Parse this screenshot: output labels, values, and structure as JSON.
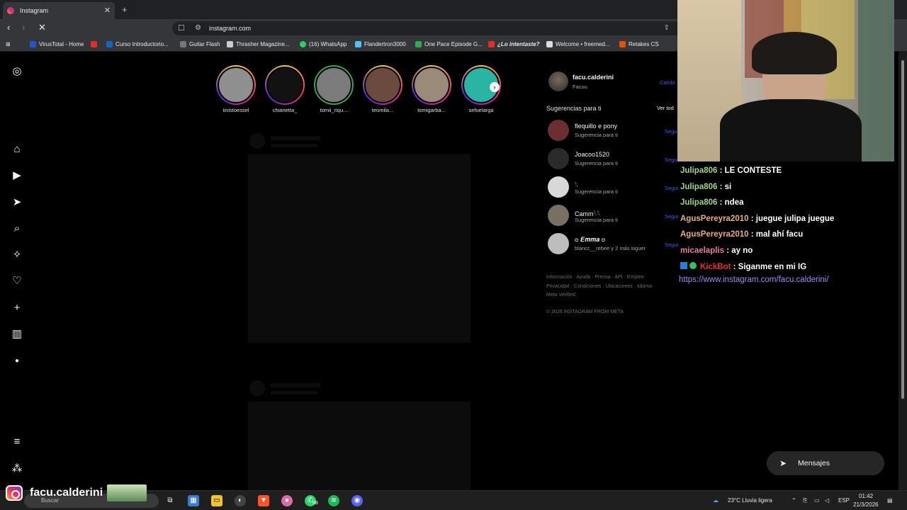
{
  "browser": {
    "tab_title": "Instagram",
    "url": "instagram.com",
    "bookmarks": [
      "VirusTotal - Home",
      "Curso Introductorio...",
      "Guitar Flash",
      "Thrasher Magazine...",
      "(16) WhatsApp",
      "Flandertron3000",
      "One Pace Episode G...",
      "¿Lo intentaste?",
      "Welcome • freemed...",
      "Retakes CS"
    ]
  },
  "stories": [
    "tinistoessel",
    "chianetta_",
    "tomii_riqu...",
    "teomila...",
    "tomigarba...",
    "sefuelarga"
  ],
  "profile": {
    "username": "facu.calderini",
    "name": "Facuu",
    "switch_label": "Cambi"
  },
  "suggestions": {
    "header": "Sugerencias para ti",
    "see_all": "Ver tod",
    "follow_label": "Segui",
    "items": [
      {
        "name": "flequillo e pony",
        "sub": "Sugerencia para ti"
      },
      {
        "name": "Joacoo1520",
        "sub": "Sugerencia para ti"
      },
      {
        "name": "𓆩",
        "sub": "Sugerencia para ti"
      },
      {
        "name": "Camm𓆩𓆩",
        "sub": "Sugerencia para ti"
      },
      {
        "name": "ᴑ 𝑬𝒎𝒎𝒂 ᴑ",
        "sub": "blancc__rebee y 2 más siguer"
      }
    ]
  },
  "footer": {
    "line1": "Información · Ayuda · Prensa · API · Empleo ·",
    "line2": "Privacidad · Condiciones · Ubicaciones · Idioma ·",
    "line3": "Meta Verified",
    "copyright": "© 2026 INSTAGRAM FROM META"
  },
  "chat": [
    {
      "user": "Julipa806",
      "text": ": LE CONTESTE",
      "color": "#9fd38a"
    },
    {
      "user": "Julipa806",
      "text": ": si",
      "color": "#9fd38a"
    },
    {
      "user": "Julipa806",
      "text": ": ndea",
      "color": "#9fd38a"
    },
    {
      "user": "AgusPereyra2010",
      "text": ": juegue julipa juegue",
      "color": "#e8b07a"
    },
    {
      "user": "AgusPereyra2010",
      "text": ": mal ahí facu",
      "color": "#e8b07a"
    },
    {
      "user": "micaelaplis",
      "text": ": ay no",
      "color": "#e57aa7"
    },
    {
      "user": "KickBot",
      "text": ": Siganme en mi IG",
      "color": "#e5332e"
    }
  ],
  "chat_link": "https://www.instagram.com/facu.calderini/",
  "messages_button": "Mensajes",
  "overlay_handle": "facu.calderini",
  "taskbar": {
    "search_placeholder": "Buscar",
    "whatsapp_badge": "88",
    "weather": "23°C  Lluvia ligera",
    "lang": "ESP",
    "time": "01:42",
    "date": "21/3/2026"
  }
}
